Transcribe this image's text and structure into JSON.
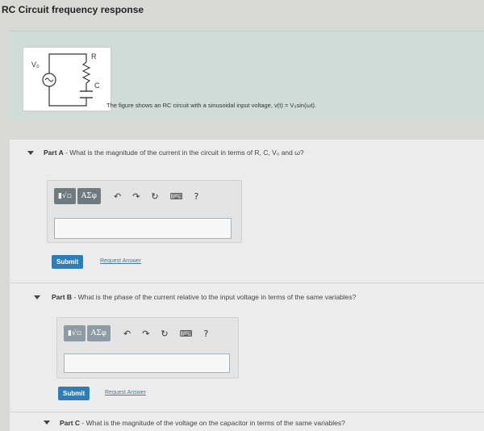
{
  "page": {
    "title": "RC Circuit frequency response"
  },
  "intro": {
    "figure_labels": {
      "vo": "V₀",
      "r": "R",
      "c": "C"
    },
    "description": "The figure shows an RC circuit with a sinusoidal input voltage, v(t) = V₀sin(ωt)."
  },
  "toolbar": {
    "template_label": "▮√▫",
    "greek_label": "AΣφ",
    "undo_icon": "undo-icon",
    "redo_icon": "redo-icon",
    "reset_icon": "reset-icon",
    "keyboard_icon": "keyboard-icon",
    "help_label": "?"
  },
  "parts": [
    {
      "label": "Part A",
      "question": " - What is the magnitude of the current in the circuit in terms of R, C, V₀ and ω?",
      "answer_value": "",
      "submit_label": "Submit",
      "request_label": "Request Answer"
    },
    {
      "label": "Part B",
      "question": " - What is the phase of the current relative to the input voltage in terms of the same variables?",
      "answer_value": "",
      "submit_label": "Submit",
      "request_label": "Request Answer"
    },
    {
      "label": "Part C",
      "question": " - What is the magnitude of the voltage on the capacitor in terms of the same variables?"
    }
  ]
}
